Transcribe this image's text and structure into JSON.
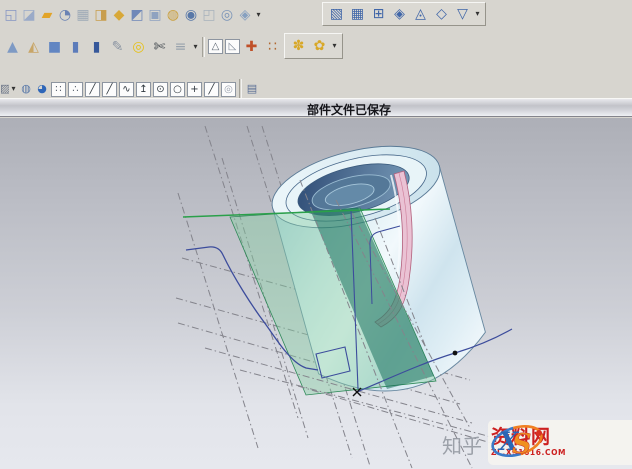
{
  "status": {
    "message": "部件文件已保存"
  },
  "watermark": {
    "site_label": "知乎",
    "logo_x": "X",
    "logo_s": "S",
    "brand": "资料网",
    "url": "ZL.XS1616.COM"
  },
  "colors": {
    "toolbar_bg": "#d7d5cf",
    "viewport_top": "#adafb7",
    "viewport_bottom": "#e6e8ee",
    "datum_plane_green": "#84cea0",
    "section_band_teal": "#0e6856",
    "cylinder_blue": "#cfe6ee",
    "hole_dark_blue": "#36547c",
    "slot_strip_pink": "#eac2d4",
    "sketch_blue": "#3c4c9c",
    "sketch_green_line": "#2aa04a",
    "datum_line_gray": "#84848c",
    "watermark_red": "#cc2020",
    "gold_icon": "#d8a828"
  },
  "toolbars": {
    "row1_left": {
      "icons": [
        {
          "name": "sketch-icon",
          "glyph": "◱",
          "color": "#8696c4"
        },
        {
          "name": "datum-plane-icon",
          "glyph": "◪",
          "color": "#9aaac8"
        },
        {
          "name": "extrude-icon",
          "glyph": "▰",
          "color": "#e2a428"
        },
        {
          "name": "revolve-icon",
          "glyph": "◔",
          "color": "#6a82b4"
        },
        {
          "name": "sweep-icon",
          "glyph": "▦",
          "color": "#9eaab6"
        },
        {
          "name": "tube-icon",
          "glyph": "◨",
          "color": "#c89e4e"
        },
        {
          "name": "boss-icon",
          "glyph": "◆",
          "color": "#d8a838"
        },
        {
          "name": "pocket-icon",
          "glyph": "◩",
          "color": "#7088b8"
        },
        {
          "name": "pad-icon",
          "glyph": "▣",
          "color": "#8fa2c0"
        },
        {
          "name": "groove-icon",
          "glyph": "◍",
          "color": "#caa040"
        },
        {
          "name": "hole-icon",
          "glyph": "◉",
          "color": "#5878a8"
        },
        {
          "name": "shell-icon",
          "glyph": "◰",
          "color": "#a8b2bc"
        },
        {
          "name": "thread-icon",
          "glyph": "◎",
          "color": "#7a94b8"
        },
        {
          "name": "boolean-unite-icon",
          "glyph": "◈",
          "color": "#86a0c0"
        },
        {
          "name": "feature-overflow-dropdown",
          "glyph": "▾",
          "dd": true
        }
      ]
    },
    "row1_right": {
      "icons": [
        {
          "name": "ruled-surface-icon",
          "glyph": "▧",
          "color": "#4066a8"
        },
        {
          "name": "through-curves-icon",
          "glyph": "▦",
          "color": "#4066a8"
        },
        {
          "name": "through-curve-mesh-icon",
          "glyph": "⊞",
          "color": "#4066a8"
        },
        {
          "name": "swept-surface-icon",
          "glyph": "◈",
          "color": "#4066a8"
        },
        {
          "name": "section-surface-icon",
          "glyph": "◬",
          "color": "#4066a8"
        },
        {
          "name": "n-sided-surface-icon",
          "glyph": "◇",
          "color": "#4066a8"
        },
        {
          "name": "bounded-plane-icon",
          "glyph": "▽",
          "color": "#4066a8"
        },
        {
          "name": "surface-overflow-dropdown",
          "glyph": "▾",
          "dd": true
        }
      ]
    },
    "row2_main": {
      "icons": [
        {
          "name": "cone-icon",
          "glyph": "▲",
          "color": "#7e9ac4"
        },
        {
          "name": "chamfer-icon",
          "glyph": "◭",
          "color": "#c8a668"
        },
        {
          "name": "block-icon",
          "glyph": "■",
          "color": "#6286c2"
        },
        {
          "name": "cylinder-icon",
          "glyph": "▮",
          "color": "#5c7cba"
        },
        {
          "name": "boss-cylinder-icon",
          "glyph": "▮",
          "color": "#36589a"
        },
        {
          "name": "thread-pencil-icon",
          "glyph": "✎",
          "color": "#8a94a2"
        },
        {
          "name": "torus-icon",
          "glyph": "◎",
          "color": "#e6c118"
        },
        {
          "name": "trim-body-icon",
          "glyph": "✄",
          "color": "#3a4148"
        },
        {
          "name": "sheet-body-icon",
          "glyph": "≡",
          "color": "#98a2ac"
        },
        {
          "name": "body-overflow-dropdown",
          "glyph": "▾",
          "dd": true
        },
        {
          "name": "separator",
          "sep": true
        },
        {
          "name": "triangle-mesh-icon",
          "glyph": "△",
          "color": "#5a6470",
          "boxed": true
        },
        {
          "name": "face-blend-icon",
          "glyph": "◺",
          "color": "#7e8896",
          "boxed": true
        },
        {
          "name": "pattern-feature-icon",
          "glyph": "✚",
          "color": "#c05028"
        },
        {
          "name": "instance-array-icon",
          "glyph": "∷",
          "color": "#b06830"
        },
        {
          "name": "pattern-overflow-dropdown",
          "glyph": "▾",
          "dd": true
        }
      ]
    },
    "row2_gold": {
      "icons": [
        {
          "name": "point-set-icon",
          "glyph": "✽",
          "color": "#d8a828"
        },
        {
          "name": "group-features-icon",
          "glyph": "✿",
          "color": "#d8a828"
        },
        {
          "name": "gold-overflow-dropdown",
          "glyph": "▾",
          "dd": true
        }
      ]
    },
    "row3_snap": {
      "icons": [
        {
          "name": "history-partial-icon",
          "glyph": "▨",
          "color": "#6a7486",
          "half": true,
          "small": true
        },
        {
          "name": "history-dropdown",
          "glyph": "▾",
          "dd": true
        },
        {
          "name": "orient-view-icon",
          "glyph": "◍",
          "color": "#5878a8",
          "small": true
        },
        {
          "name": "shaded-view-icon",
          "glyph": "◕",
          "color": "#2e66b8",
          "small": true
        },
        {
          "name": "snap-end-point-icon",
          "glyph": "∷",
          "color": "#5a626e",
          "boxed": true
        },
        {
          "name": "snap-mid-point-icon",
          "glyph": "∴",
          "color": "#5a626e",
          "boxed": true
        },
        {
          "name": "snap-line-icon",
          "glyph": "╱",
          "color": "#30383f",
          "boxed": true
        },
        {
          "name": "snap-parallel-line-icon",
          "glyph": "╱",
          "color": "#30383f",
          "boxed": true
        },
        {
          "name": "snap-spline-icon",
          "glyph": "∿",
          "color": "#30383f",
          "boxed": true
        },
        {
          "name": "snap-point-icon",
          "glyph": "↥",
          "color": "#30383f",
          "boxed": true
        },
        {
          "name": "snap-center-point-icon",
          "glyph": "⊙",
          "color": "#30383f",
          "boxed": true
        },
        {
          "name": "snap-circle-icon",
          "glyph": "○",
          "color": "#30383f",
          "boxed": true
        },
        {
          "name": "snap-intersection-icon",
          "glyph": "+",
          "color": "#30383f",
          "boxed": true
        },
        {
          "name": "snap-segment-icon",
          "glyph": "╱",
          "color": "#30383f",
          "boxed": true
        },
        {
          "name": "quick-pick-icon",
          "glyph": "◎",
          "color": "#9aa2ae",
          "boxed": true
        },
        {
          "name": "spacer",
          "sep": true
        },
        {
          "name": "layer-book-icon",
          "glyph": "▤",
          "color": "#5a6e94",
          "small": true
        }
      ]
    }
  }
}
